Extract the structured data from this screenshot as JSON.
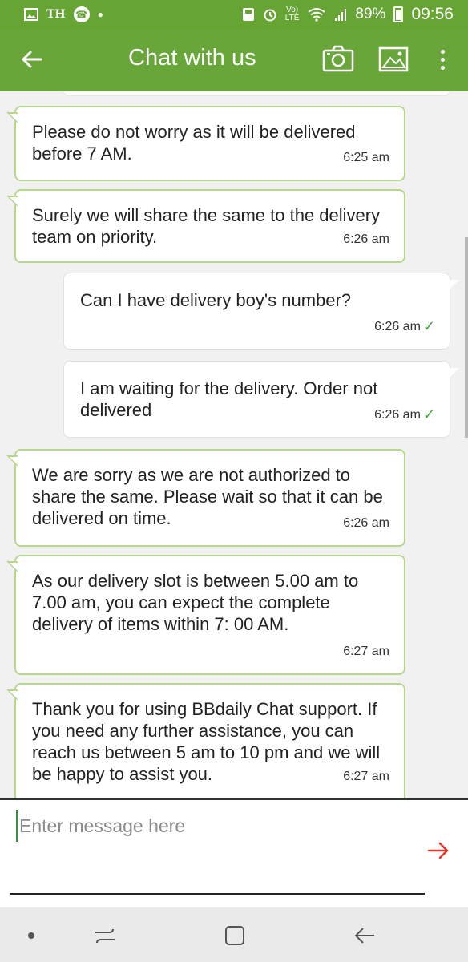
{
  "status_bar": {
    "carrier": "TH",
    "lte_line1": "Vo)",
    "lte_line2": "LTE",
    "battery": "89%",
    "time": "09:56",
    "icons": [
      "image-icon",
      "call-icon",
      "notification-dot",
      "save-icon",
      "alarm-icon",
      "volte-icon",
      "wifi-icon",
      "signal-icon",
      "battery-icon"
    ]
  },
  "app_bar": {
    "title": "Chat with us",
    "color": "#69a63a",
    "icons": [
      "back-arrow-icon",
      "camera-icon",
      "gallery-icon",
      "more-vertical-icon"
    ]
  },
  "messages": [
    {
      "sender": "agent",
      "text": "Please do not worry as it will be delivered before 7 AM.",
      "time": "6:25 am"
    },
    {
      "sender": "agent",
      "text": "Surely we will share the same to the delivery team on priority.",
      "time": "6:26 am"
    },
    {
      "sender": "user",
      "text": "Can I have delivery boy's number?",
      "time": "6:26 am",
      "status": "✓"
    },
    {
      "sender": "user",
      "text": "I am waiting for the delivery. Order not delivered",
      "time": "6:26 am",
      "status": "✓"
    },
    {
      "sender": "agent",
      "text": "We are sorry as we are not authorized to share the same. Please wait so that it can be delivered on time.",
      "time": "6:26 am"
    },
    {
      "sender": "agent",
      "text": "As our delivery slot is between 5.00 am to 7.00 am, you can expect the complete delivery of items within 7: 00 AM.",
      "time": "6:27 am"
    },
    {
      "sender": "agent",
      "text": "Thank you for using BBdaily Chat support. If you need any further assistance, you can reach us between 5 am to 10 pm and we will be happy to assist you.",
      "time": "6:27 am"
    }
  ],
  "input": {
    "value": "",
    "placeholder": "Enter message here",
    "send_icon": "send-arrow-icon",
    "send_color": "#e0352b"
  },
  "nav_bar": {
    "icons": [
      "nav-dot-icon",
      "recents-icon",
      "home-icon",
      "back-icon"
    ]
  }
}
